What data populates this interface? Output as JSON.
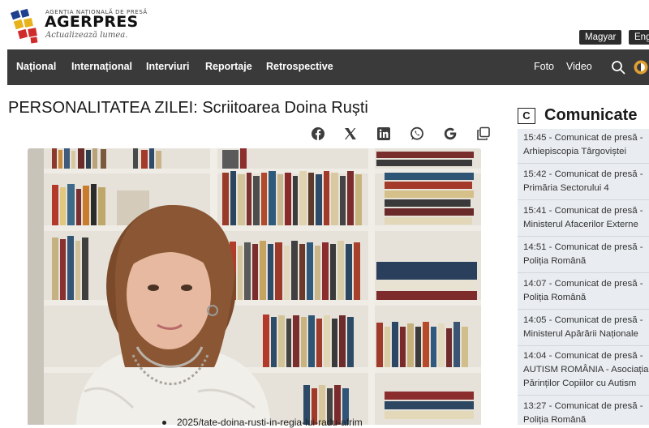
{
  "header": {
    "agency_small": "AGENȚIA NAȚIONALĂ DE PRESĂ",
    "brand": "AGERPRES",
    "tagline": "Actualizează lumea.",
    "languages": [
      "Magyar",
      "Eng"
    ]
  },
  "nav": {
    "items": [
      "Național",
      "Internațional",
      "Interviuri",
      "Reportaje",
      "Retrospective"
    ],
    "right": [
      "Foto",
      "Video"
    ]
  },
  "article": {
    "title": "PERSONALITATEA ZILEI: Scriitoarea Doina Ruști",
    "share_icons": [
      "facebook-icon",
      "x-icon",
      "linkedin-icon",
      "whatsapp-icon",
      "google-icon",
      "copy-icon"
    ],
    "link_text": "2025/tate-doina-rusti-in-regia-lui-radu-afrim"
  },
  "sidebar": {
    "badge": "C",
    "title": "Comunicate",
    "items": [
      {
        "line1": "15:45 - Comunicat de presă -",
        "line2": "Arhiepiscopia Târgoviștei"
      },
      {
        "line1": "15:42 - Comunicat de presă -",
        "line2": "Primăria Sectorului 4"
      },
      {
        "line1": "15:41 - Comunicat de presă -",
        "line2": "Ministerul Afacerilor Externe"
      },
      {
        "line1": "14:51 - Comunicat de presă -",
        "line2": "Poliția Română"
      },
      {
        "line1": "14:07 - Comunicat de presă -",
        "line2": "Poliția Română"
      },
      {
        "line1": "14:05 - Comunicat de presă -",
        "line2": "Ministerul Apărării Naționale"
      },
      {
        "line1": "14:04 - Comunicat de presă -",
        "line2": "AUTISM ROMÂNIA - Asociația",
        "line3": "Părinților Copiilor cu Autism"
      },
      {
        "line1": "13:27 - Comunicat de presă -",
        "line2": "Poliția Română"
      }
    ]
  },
  "colors": {
    "nav_bg": "#3a3a3a",
    "sidebar_bg": "#e9ecf0",
    "mode_icon": "#e0a030"
  }
}
